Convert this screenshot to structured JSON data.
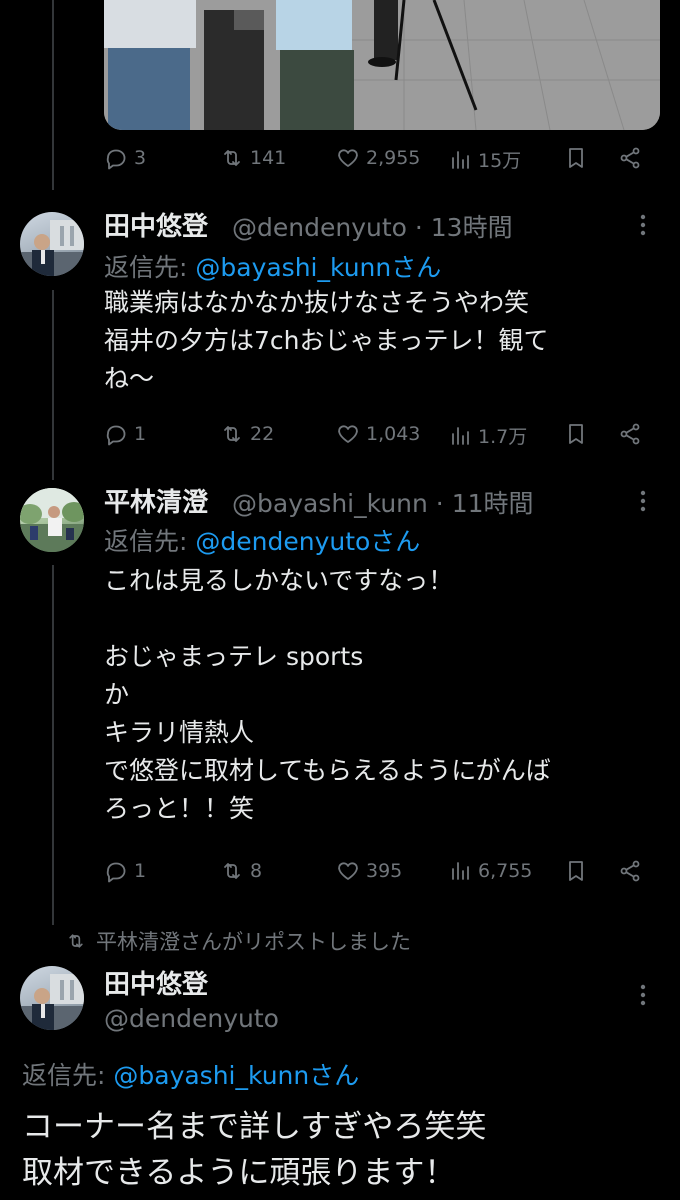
{
  "tweet0": {
    "replies": "3",
    "retweets": "141",
    "likes": "2,955",
    "views": "15万"
  },
  "tweet1": {
    "name": "田中悠登",
    "handle_time": "@dendenyuto · 13時間",
    "reply_prefix": "返信先: ",
    "reply_to": "@bayashi_kunnさん",
    "text": "職業病はなかなか抜けなさそうやわ笑\n福井の夕方は7chおじゃまっテレ！観て\nね〜",
    "replies": "1",
    "retweets": "22",
    "likes": "1,043",
    "views": "1.7万"
  },
  "tweet2": {
    "name": "平林清澄",
    "handle_time": "@bayashi_kunn · 11時間",
    "reply_prefix": "返信先: ",
    "reply_to": "@dendenyutoさん",
    "text": "これは見るしかないですなっ！\n\nおじゃまっテレ sports\nか\nキラリ情熱人\nで悠登に取材してもらえるようにがんば\nろっと！！笑",
    "replies": "1",
    "retweets": "8",
    "likes": "395",
    "views": "6,755"
  },
  "tweet3": {
    "repost_note": "平林清澄さんがリポストしました",
    "name": "田中悠登",
    "handle": "@dendenyuto",
    "reply_prefix": "返信先: ",
    "reply_to": "@bayashi_kunnさん",
    "text": "コーナー名まで詳しすぎやろ笑笑\n取材できるように頑張ります！"
  },
  "icons": [
    "reply-icon",
    "retweet-icon",
    "like-icon",
    "views-icon",
    "bookmark-icon",
    "share-icon",
    "more-icon"
  ],
  "colors": {
    "background": "#000000",
    "text": "#e7e9ea",
    "muted": "#71767b",
    "link": "#1d9bf0"
  }
}
